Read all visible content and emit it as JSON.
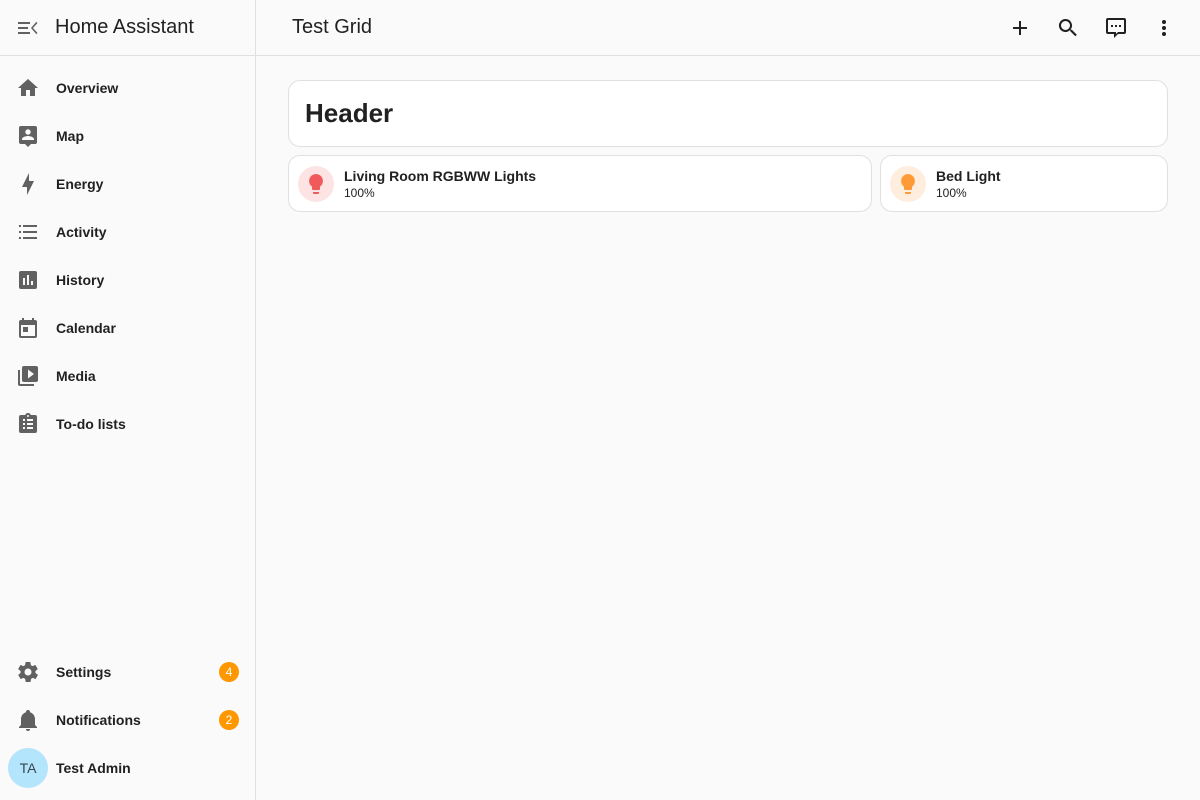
{
  "sidebar": {
    "title": "Home Assistant",
    "items": [
      {
        "label": "Overview",
        "icon": "home-icon"
      },
      {
        "label": "Map",
        "icon": "map-icon"
      },
      {
        "label": "Energy",
        "icon": "lightning-icon"
      },
      {
        "label": "Activity",
        "icon": "list-icon"
      },
      {
        "label": "History",
        "icon": "chart-box-icon"
      },
      {
        "label": "Calendar",
        "icon": "calendar-icon"
      },
      {
        "label": "Media",
        "icon": "play-box-icon"
      },
      {
        "label": "To-do lists",
        "icon": "clipboard-list-icon"
      }
    ],
    "settings": {
      "label": "Settings",
      "badge": "4"
    },
    "notifications": {
      "label": "Notifications",
      "badge": "2"
    },
    "user": {
      "initials": "TA",
      "name": "Test Admin"
    }
  },
  "topbar": {
    "title": "Test Grid",
    "actions": [
      "plus-icon",
      "search-icon",
      "assist-icon",
      "more-vert-icon"
    ]
  },
  "main": {
    "header_card": {
      "title": "Header"
    },
    "tiles": [
      {
        "name": "Living Room RGBWW Lights",
        "state": "100%",
        "icon": "lightbulb-icon",
        "color": "#f05a5a"
      },
      {
        "name": "Bed Light",
        "state": "100%",
        "icon": "lightbulb-icon",
        "color": "#ff9b36"
      }
    ]
  },
  "colors": {
    "badge": "#ff9800",
    "avatar_bg": "#b3e5fc"
  }
}
